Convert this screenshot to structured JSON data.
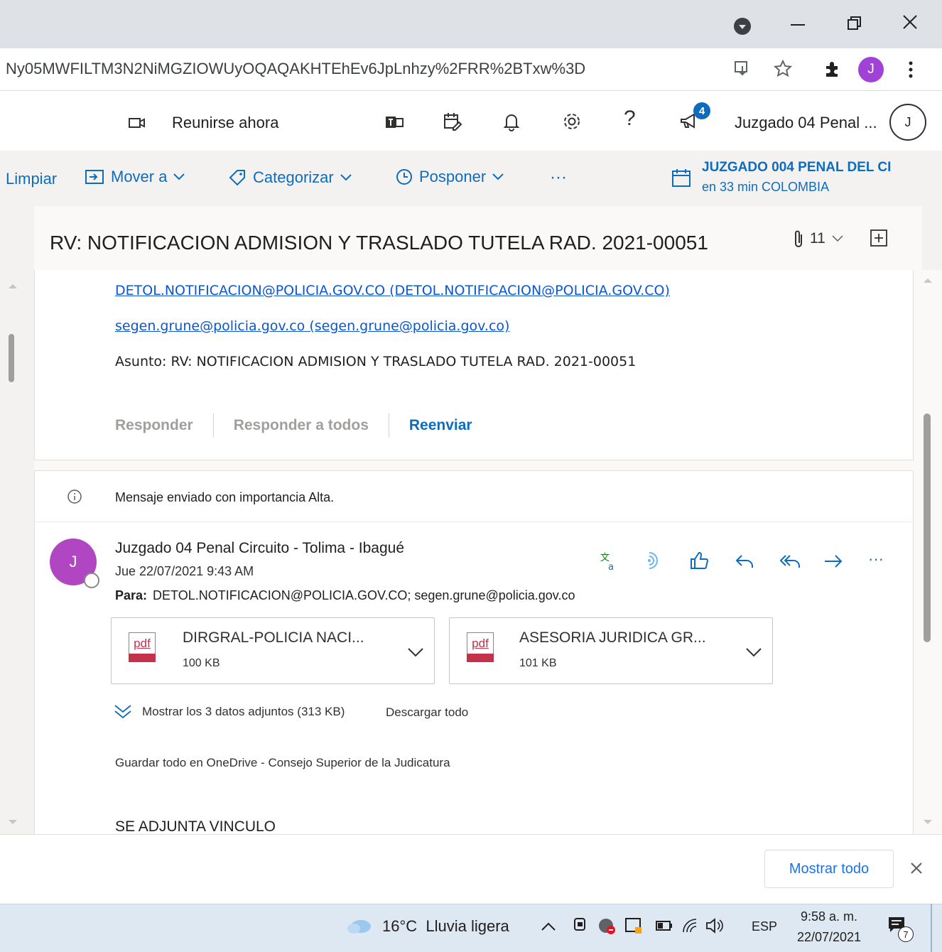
{
  "browser": {
    "url": "Ny05MWFILTM3N2NiMGZIOWUyOQAQAKHTEhEv6JpLnhzy%2FRR%2BTxw%3D",
    "profile_initial": "J"
  },
  "outlook_header": {
    "meet_now": "Reunirse ahora",
    "notification_badge": "4",
    "account_name": "Juzgado 04 Penal ...",
    "avatar_initial": "J"
  },
  "command_bar": {
    "clean": "Limpiar",
    "move_to": "Mover a",
    "categorize": "Categorizar",
    "snooze": "Posponer",
    "more": "···",
    "reminder_title": "JUZGADO 004 PENAL DEL CI",
    "reminder_sub": "en 33 min COLOMBIA"
  },
  "message": {
    "subject": "RV: NOTIFICACION ADMISION Y TRASLADO TUTELA RAD. 2021-00051",
    "attachment_count": "11"
  },
  "quoted": {
    "link1": "DETOL.NOTIFICACION@POLICIA.GOV.CO (DETOL.NOTIFICACION@POLICIA.GOV.CO)",
    "link2": "segen.grune@policia.gov.co (segen.grune@policia.gov.co)",
    "subject_line": "Asunto: RV: NOTIFICACION ADMISION Y TRASLADO TUTELA RAD. 2021-00051"
  },
  "reply_actions": {
    "reply": "Responder",
    "reply_all": "Responder a todos",
    "forward": "Reenviar"
  },
  "email": {
    "importance": "Mensaje enviado con importancia Alta.",
    "sender_initial": "J",
    "sender": "Juzgado 04 Penal Circuito - Tolima - Ibagué",
    "date": "Jue 22/07/2021 9:43 AM",
    "to_label": "Para:",
    "to": "DETOL.NOTIFICACION@POLICIA.GOV.CO; segen.grune@policia.gov.co",
    "more": "···",
    "attachments": [
      {
        "name": "DIRGRAL-POLICIA NACI...",
        "size": "100 KB",
        "icon_text": "pdf"
      },
      {
        "name": "ASESORIA JURIDICA GR...",
        "size": "101 KB",
        "icon_text": "pdf"
      }
    ],
    "show_attachments": "Mostrar los 3 datos adjuntos (313 KB)",
    "download_all": "Descargar todo",
    "save_onedrive": "Guardar todo en OneDrive - Consejo Superior de la Judicatura",
    "body_start": "SE ADJUNTA VINCULO"
  },
  "downloads_bar": {
    "show_all": "Mostrar todo"
  },
  "taskbar": {
    "weather": "16°C  Lluvia ligera",
    "language": "ESP",
    "time": "9:58 a. m.",
    "date": "22/07/2021",
    "notifications": "7"
  }
}
